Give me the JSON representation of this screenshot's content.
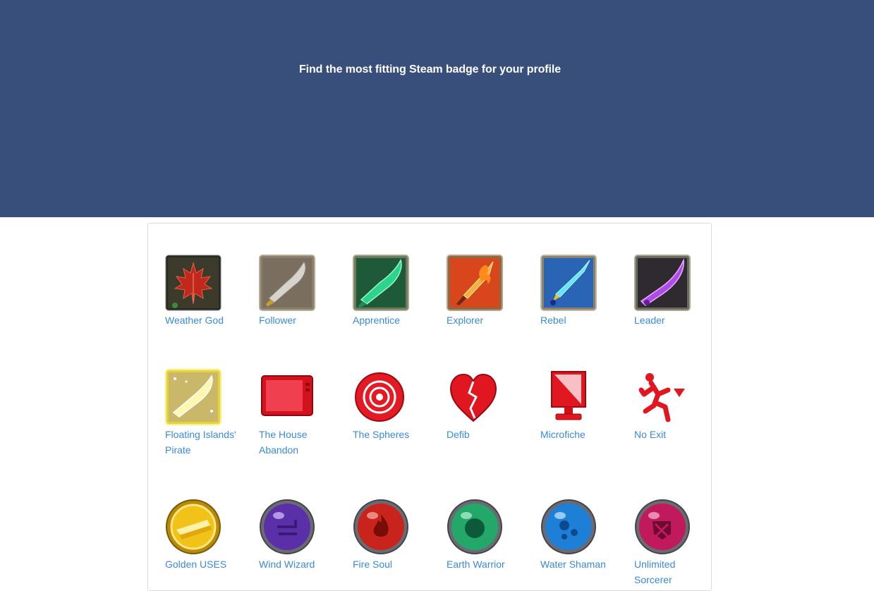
{
  "hero": {
    "title": "Find the most fitting Steam badge for your profile"
  },
  "colors": {
    "hero_bg": "#374f7a",
    "link": "#3a8ad8"
  },
  "badges": [
    {
      "name": "Weather God",
      "icon": "maple-leaf-icon"
    },
    {
      "name": "Follower",
      "icon": "stone-blade-icon"
    },
    {
      "name": "Apprentice",
      "icon": "green-blade-icon"
    },
    {
      "name": "Explorer",
      "icon": "fire-sword-icon"
    },
    {
      "name": "Rebel",
      "icon": "ice-sword-icon"
    },
    {
      "name": "Leader",
      "icon": "purple-blade-icon"
    },
    {
      "name": "Floating Islands' Pirate",
      "icon": "golden-blade-icon"
    },
    {
      "name": "The House Abandon",
      "icon": "red-tv-icon"
    },
    {
      "name": "The Spheres",
      "icon": "red-target-icon"
    },
    {
      "name": "Defib",
      "icon": "broken-heart-icon"
    },
    {
      "name": "Microfiche",
      "icon": "red-monitor-icon"
    },
    {
      "name": "No Exit",
      "icon": "running-man-icon"
    },
    {
      "name": "Golden USES",
      "icon": "gold-coin-icon"
    },
    {
      "name": "Wind Wizard",
      "icon": "purple-orb-icon"
    },
    {
      "name": "Fire Soul",
      "icon": "red-orb-icon"
    },
    {
      "name": "Earth Warrior",
      "icon": "green-orb-icon"
    },
    {
      "name": "Water Shaman",
      "icon": "blue-orb-icon"
    },
    {
      "name": "Unlimited Sorcerer",
      "icon": "magenta-orb-icon"
    }
  ]
}
